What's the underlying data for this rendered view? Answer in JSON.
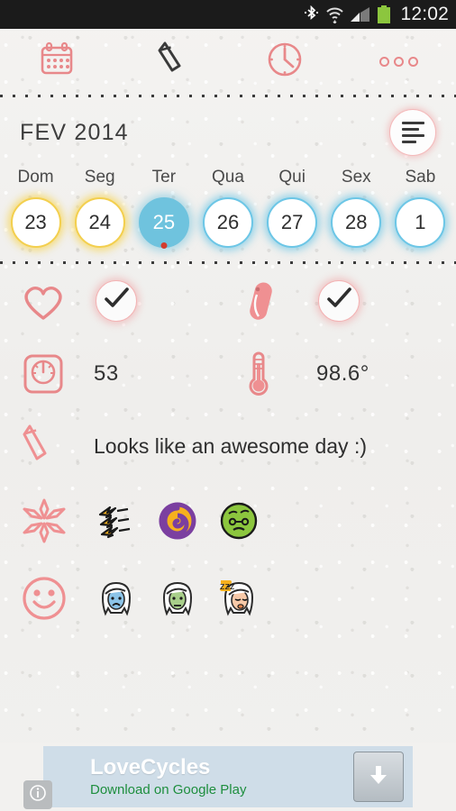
{
  "statusbar": {
    "time": "12:02",
    "icons": [
      "bluetooth-icon",
      "wifi-icon",
      "cellular-signal-icon",
      "battery-icon"
    ]
  },
  "toolbar": {
    "items": [
      {
        "name": "calendar-tab",
        "icon": "calendar-icon",
        "active": false
      },
      {
        "name": "notes-tab",
        "icon": "pencil-icon",
        "active": true
      },
      {
        "name": "history-tab",
        "icon": "clock-icon",
        "active": false
      },
      {
        "name": "more-tab",
        "icon": "overflow-dots-icon",
        "active": false
      }
    ]
  },
  "header": {
    "month": "FEV",
    "year": "2014",
    "month_year": "FEV  2014",
    "summary_button": "summary-lines-icon"
  },
  "week": {
    "day_names": [
      "Dom",
      "Seg",
      "Ter",
      "Qua",
      "Qui",
      "Sex",
      "Sab"
    ],
    "days": [
      {
        "number": "23",
        "style": "ring-yellow",
        "dot": false
      },
      {
        "number": "24",
        "style": "ring-yellow",
        "dot": false
      },
      {
        "number": "25",
        "style": "fill-blue",
        "dot": true,
        "selected": true
      },
      {
        "number": "26",
        "style": "ring-blue",
        "dot": false
      },
      {
        "number": "27",
        "style": "ring-blue",
        "dot": false
      },
      {
        "number": "28",
        "style": "ring-blue",
        "dot": false
      },
      {
        "number": "1",
        "style": "ring-blue",
        "dot": false
      }
    ]
  },
  "entries": {
    "intimacy": {
      "icon": "heart-icon",
      "checked": true,
      "check_icon": "checkmark-icon"
    },
    "pill": {
      "icon": "pill-icon",
      "checked": true,
      "check_icon": "checkmark-icon"
    },
    "weight": {
      "icon": "weight-scale-icon",
      "value": "53"
    },
    "temperature": {
      "icon": "thermometer-icon",
      "value": "98.6°"
    },
    "note": {
      "icon": "pencil-note-icon",
      "text": "Looks like an awesome day :)"
    },
    "symptoms": {
      "icon": "symptoms-asterisk-icon",
      "selected": [
        {
          "name": "cramps-symptom",
          "label": "cramps"
        },
        {
          "name": "dizziness-symptom",
          "label": "dizziness"
        },
        {
          "name": "nausea-symptom",
          "label": "nausea"
        }
      ]
    },
    "moods": {
      "icon": "mood-smiley-icon",
      "selected": [
        {
          "name": "sad-mood",
          "label": "sad"
        },
        {
          "name": "sick-mood",
          "label": "sick"
        },
        {
          "name": "tired-mood",
          "label": "tired"
        }
      ]
    }
  },
  "ad": {
    "title": "LoveCycles",
    "subtitle": "Download on Google Play",
    "download_icon": "download-arrow-icon",
    "info_icon": "ad-info-icon"
  },
  "colors": {
    "accent_pink": "#e8888a",
    "selected_blue": "#6fc3de",
    "ring_yellow": "#f3cf4e",
    "dot_red": "#d23c2e",
    "play_green": "#1e8e3e"
  }
}
